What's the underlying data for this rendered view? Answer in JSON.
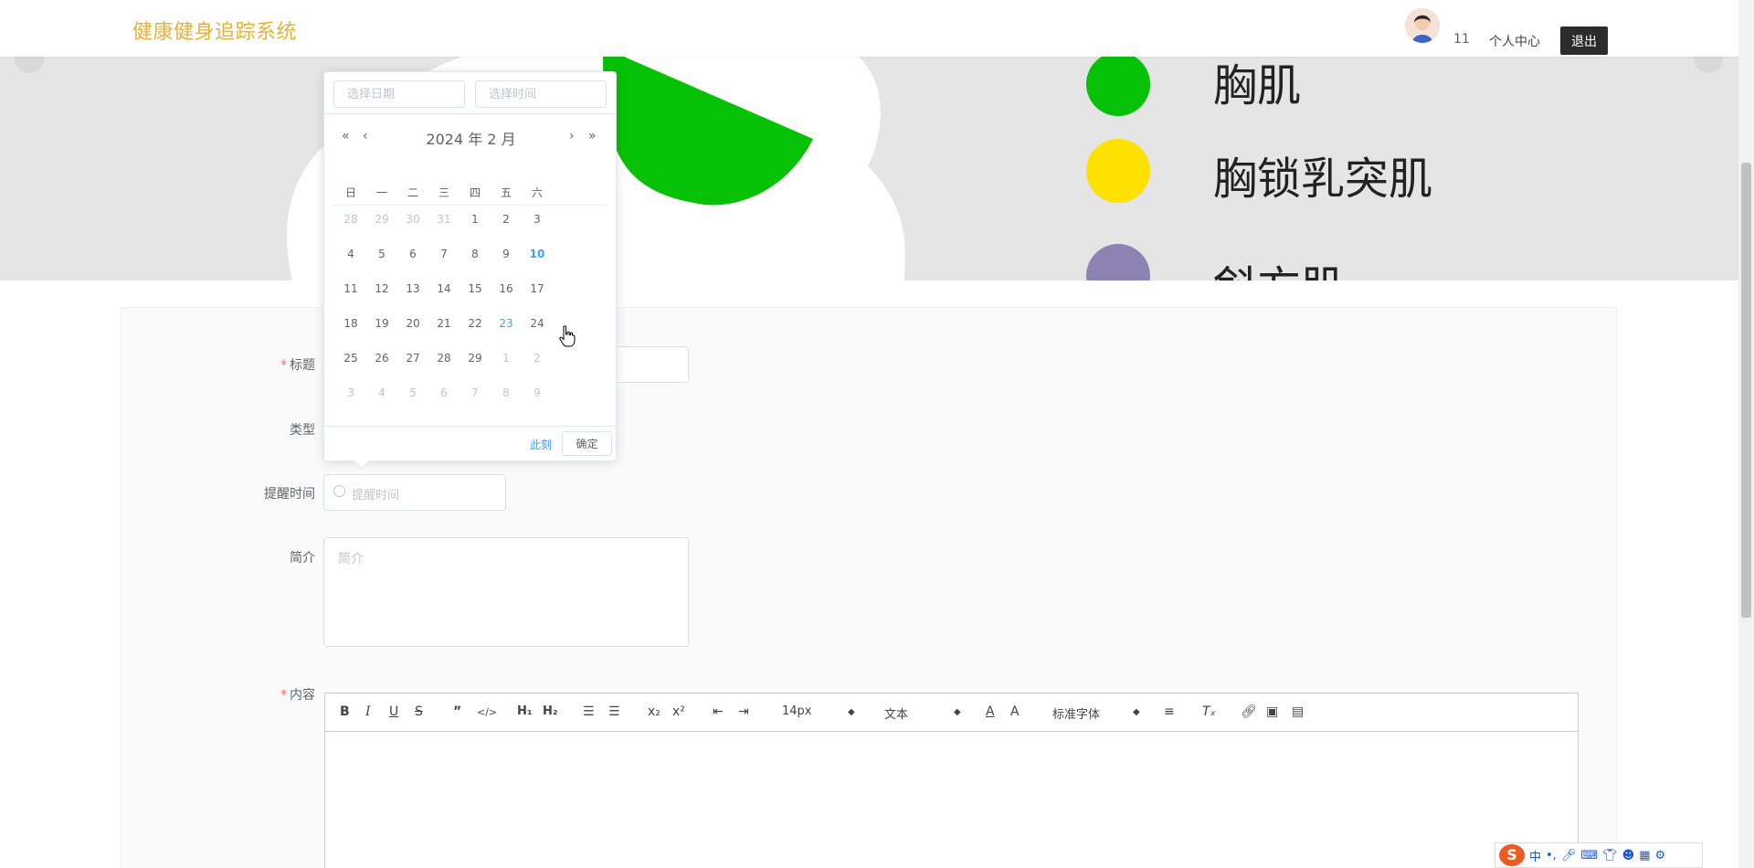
{
  "header": {
    "brand": "健康健身追踪系统",
    "username": "11",
    "personal_center": "个人中心",
    "logout": "退出"
  },
  "banner": {
    "legend": [
      "胸肌",
      "胸锁乳突肌",
      "斜方肌"
    ],
    "legend_colors": [
      "#07c107",
      "#ffe100",
      "#8d83b3"
    ]
  },
  "form": {
    "title_label": "标题",
    "type_label": "类型",
    "remind_label": "提醒时间",
    "remind_placeholder": "提醒时间",
    "intro_label": "简介",
    "intro_placeholder": "简介",
    "content_label": "内容"
  },
  "picker": {
    "date_placeholder": "选择日期",
    "time_placeholder": "选择时间",
    "title": "2024 年  2 月",
    "weekdays": [
      "日",
      "一",
      "二",
      "三",
      "四",
      "五",
      "六"
    ],
    "weeks": [
      [
        [
          "28",
          "prev"
        ],
        [
          "29",
          "prev"
        ],
        [
          "30",
          "prev"
        ],
        [
          "31",
          "prev"
        ],
        [
          "1",
          ""
        ],
        [
          "2",
          ""
        ],
        [
          "3",
          ""
        ]
      ],
      [
        [
          "4",
          ""
        ],
        [
          "5",
          ""
        ],
        [
          "6",
          ""
        ],
        [
          "7",
          ""
        ],
        [
          "8",
          ""
        ],
        [
          "9",
          ""
        ],
        [
          "10",
          "today"
        ]
      ],
      [
        [
          "11",
          ""
        ],
        [
          "12",
          ""
        ],
        [
          "13",
          ""
        ],
        [
          "14",
          ""
        ],
        [
          "15",
          ""
        ],
        [
          "16",
          ""
        ],
        [
          "17",
          ""
        ]
      ],
      [
        [
          "18",
          ""
        ],
        [
          "19",
          ""
        ],
        [
          "20",
          ""
        ],
        [
          "21",
          ""
        ],
        [
          "22",
          ""
        ],
        [
          "23",
          "sel"
        ],
        [
          "24",
          ""
        ]
      ],
      [
        [
          "25",
          ""
        ],
        [
          "26",
          ""
        ],
        [
          "27",
          ""
        ],
        [
          "28",
          ""
        ],
        [
          "29",
          ""
        ],
        [
          "1",
          "next"
        ],
        [
          "2",
          "next"
        ]
      ],
      [
        [
          "3",
          "next"
        ],
        [
          "4",
          "next"
        ],
        [
          "5",
          "next"
        ],
        [
          "6",
          "next"
        ],
        [
          "7",
          "next"
        ],
        [
          "8",
          "next"
        ],
        [
          "9",
          "next"
        ]
      ]
    ],
    "now": "此刻",
    "confirm": "确定"
  },
  "editor": {
    "font_size": "14px",
    "paragraph": "文本",
    "font_family": "标准字体"
  },
  "ime": {
    "lang": "中"
  }
}
